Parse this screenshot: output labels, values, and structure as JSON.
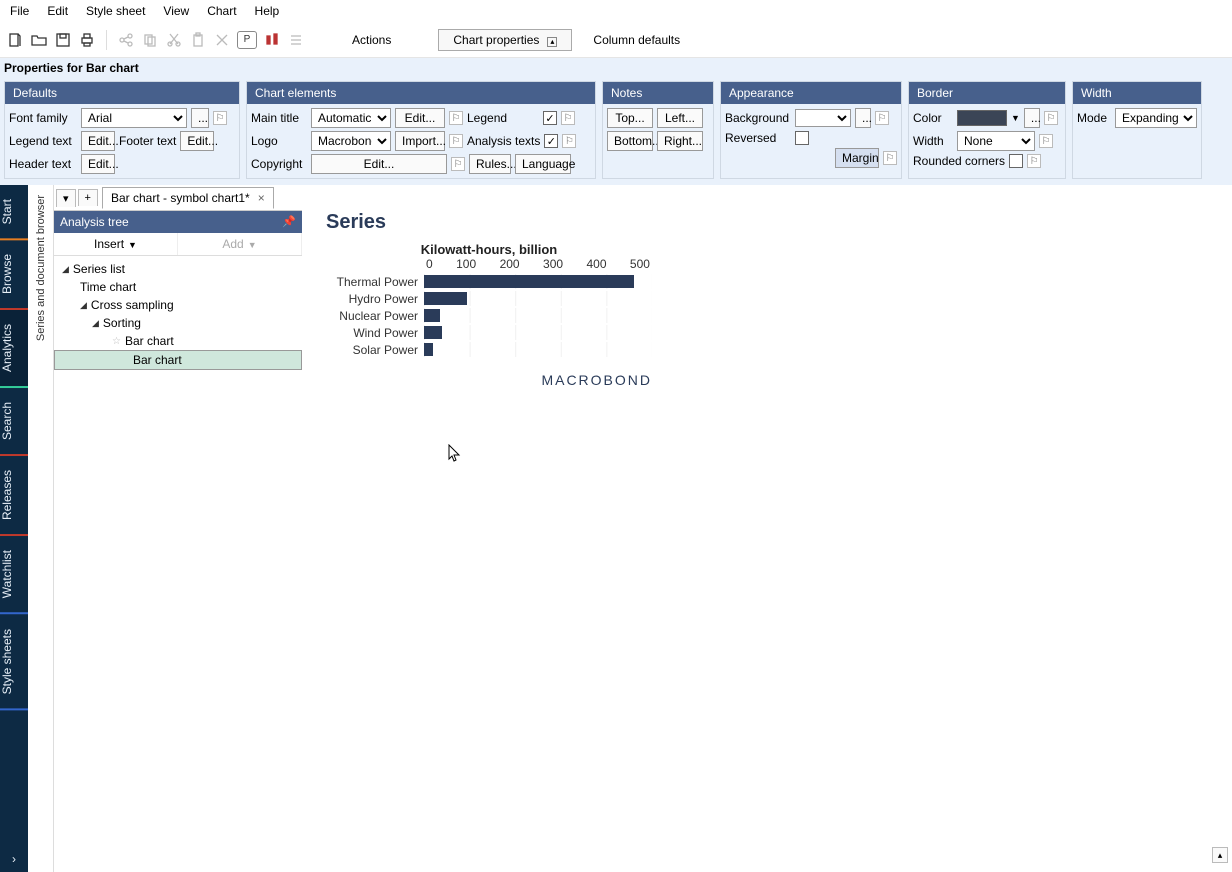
{
  "menu": {
    "file": "File",
    "edit": "Edit",
    "stylesheet": "Style sheet",
    "view": "View",
    "chart": "Chart",
    "help": "Help"
  },
  "toolbar": {
    "actions": "Actions",
    "chart_props": "Chart properties",
    "col_defaults": "Column defaults"
  },
  "props_title": "Properties for Bar chart",
  "defaults": {
    "title": "Defaults",
    "font_family": "Font family",
    "font_family_val": "Arial",
    "legend_text": "Legend text",
    "footer_text": "Footer text",
    "header_text": "Header text",
    "edit": "Edit...",
    "more": "..."
  },
  "chart_elements": {
    "title": "Chart elements",
    "main_title": "Main title",
    "main_title_val": "Automatic",
    "logo": "Logo",
    "logo_val": "Macrobond",
    "import": "Import...",
    "copyright": "Copyright",
    "legend": "Legend",
    "analysis_texts": "Analysis texts",
    "rules": "Rules...",
    "language": "Language",
    "edit": "Edit..."
  },
  "notes": {
    "title": "Notes",
    "top": "Top...",
    "left": "Left...",
    "bottom": "Bottom...",
    "right": "Right..."
  },
  "appearance": {
    "title": "Appearance",
    "background": "Background",
    "reversed": "Reversed",
    "margin": "Margin"
  },
  "border": {
    "title": "Border",
    "color": "Color",
    "width": "Width",
    "width_val": "None",
    "rounded": "Rounded corners"
  },
  "width": {
    "title": "Width",
    "mode": "Mode",
    "mode_val": "Expanding"
  },
  "rail": {
    "start": "Start",
    "browse": "Browse",
    "analytics": "Analytics",
    "search": "Search",
    "releases": "Releases",
    "watchlist": "Watchlist",
    "stylesheets": "Style sheets"
  },
  "doc_browser": "Series and document browser",
  "tab": "Bar chart - symbol chart1*",
  "tree": {
    "title": "Analysis tree",
    "insert": "Insert",
    "add": "Add",
    "series_list": "Series list",
    "time_chart": "Time chart",
    "cross_sampling": "Cross sampling",
    "sorting": "Sorting",
    "bar_chart": "Bar chart"
  },
  "chart_data": {
    "type": "bar",
    "title": "Series",
    "xlabel": "Kilowatt-hours, billion",
    "ticks": [
      0,
      100,
      200,
      300,
      400,
      500
    ],
    "xmax": 500,
    "categories": [
      "Thermal Power",
      "Hydro Power",
      "Nuclear Power",
      "Wind Power",
      "Solar Power"
    ],
    "values": [
      460,
      95,
      35,
      40,
      20
    ]
  },
  "brand": "MACROBOND"
}
